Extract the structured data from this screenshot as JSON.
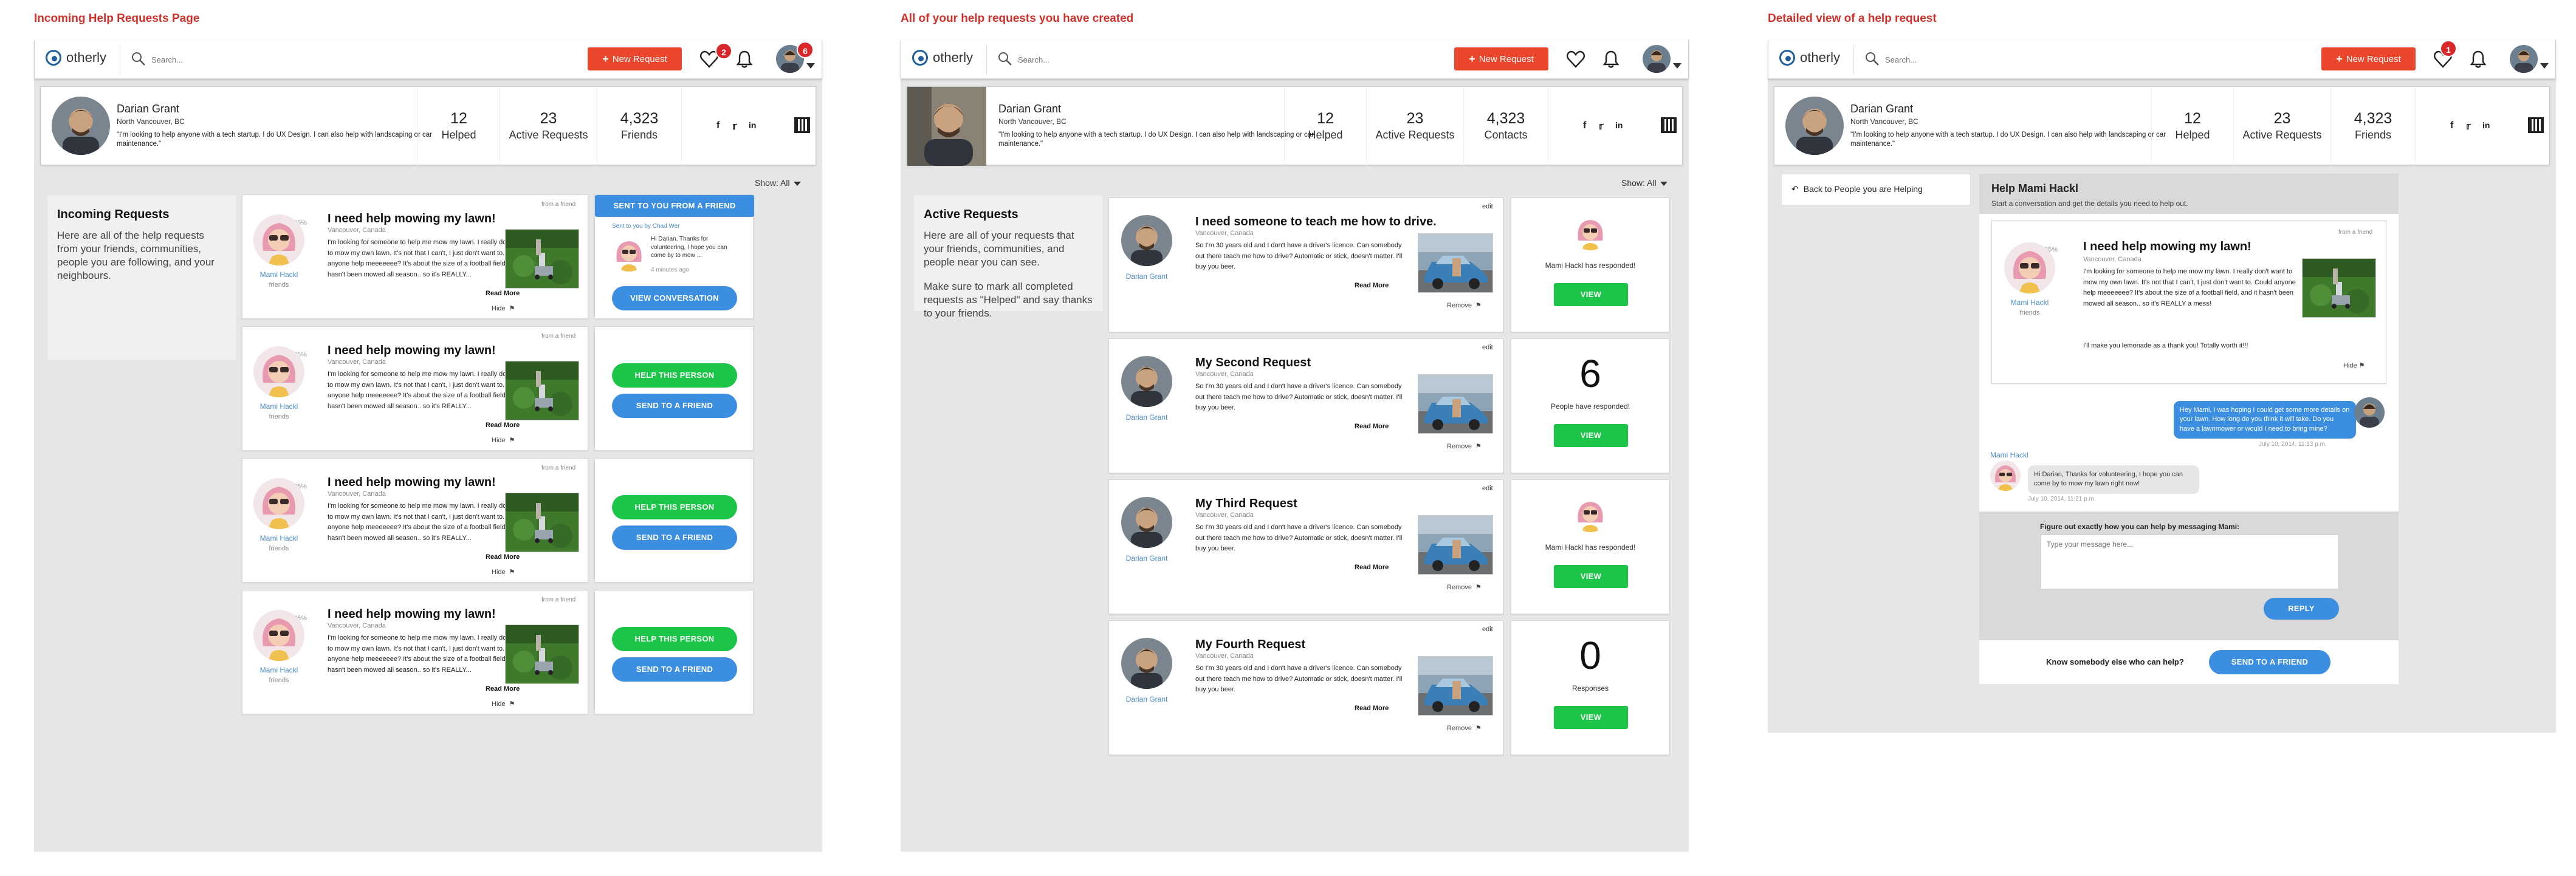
{
  "app": {
    "logo_text": "otherly",
    "search_placeholder": "Search...",
    "new_request_label": "New Request"
  },
  "colors": {
    "accent_red": "#e9462b",
    "green": "#1bc548",
    "blue": "#3b8ee0",
    "link_blue": "#4a8cc9",
    "title_red": "#d0302a"
  },
  "panels": [
    {
      "title": "Incoming Help Requests Page",
      "heart_badge": "2",
      "avatar_badge": "6",
      "profile": {
        "name": "Darian Grant",
        "location": "North Vancouver, BC",
        "bio": "\"I'm looking to help anyone with a tech startup. I do UX Design. I can also help with landscaping or car maintenance.\"",
        "stats": [
          {
            "value": "12",
            "label": "Helped"
          },
          {
            "value": "23",
            "label": "Active Requests"
          },
          {
            "value": "4,323",
            "label": "Friends"
          }
        ]
      },
      "show_filter": {
        "label": "Show:",
        "value": "All"
      },
      "sidebar": {
        "heading": "Incoming Requests",
        "paragraphs": [
          "Here are all of the help requests from your friends, communities, people you are following, and your neighbours."
        ]
      },
      "requests": [
        {
          "from": "from a friend",
          "pct": "85%",
          "name": "Mami Hackl",
          "relation": "friends",
          "title": "I need help mowing my lawn!",
          "location": "Vancouver, Canada",
          "body": "I'm looking for someone to help me mow my lawn. I really don't want to mow my own lawn. It's not that I can't, I just don't want to. Could anyone help meeeeeee? It's about the size of a football field, and it hasn't been mowed all season.. so it's REALLY...",
          "read_more": "Read More",
          "hide": "Hide"
        },
        {
          "from": "from a friend",
          "pct": "85%",
          "name": "Mami Hackl",
          "relation": "friends",
          "title": "I need help mowing my lawn!",
          "location": "Vancouver, Canada",
          "body": "I'm looking for someone to help me mow my lawn. I really don't want to mow my own lawn. It's not that I can't, I just don't want to. Could anyone help meeeeeee? It's about the size of a football field, and it hasn't been mowed all season.. so it's REALLY...",
          "read_more": "Read More",
          "hide": "Hide"
        },
        {
          "from": "from a friend",
          "pct": "85%",
          "name": "Mami Hackl",
          "relation": "friends",
          "title": "I need help mowing my lawn!",
          "location": "Vancouver, Canada",
          "body": "I'm looking for someone to help me mow my lawn. I really don't want to mow my own lawn. It's not that I can't, I just don't want to. Could anyone help meeeeeee? It's about the size of a football field, and it hasn't been mowed all season.. so it's REALLY...",
          "read_more": "Read More",
          "hide": "Hide"
        },
        {
          "from": "from a friend",
          "pct": "85%",
          "name": "Mami Hackl",
          "relation": "friends",
          "title": "I need help mowing my lawn!",
          "location": "Vancouver, Canada",
          "body": "I'm looking for someone to help me mow my lawn. I really don't want to mow my own lawn. It's not that I can't, I just don't want to. Could anyone help meeeeeee? It's about the size of a football field, and it hasn't been mowed all season.. so it's REALLY...",
          "read_more": "Read More",
          "hide": "Hide"
        }
      ],
      "actions": {
        "friend_header": "SENT TO YOU FROM A FRIEND",
        "sent_by": "Sent to you by Chad Wer",
        "message": "Hi Darian, Thanks for volunteering, I hope you can come by to mow ...",
        "time": "4 minutes ago",
        "view_conversation": "VIEW CONVERSATION",
        "help": "HELP THIS PERSON",
        "send": "SEND TO A FRIEND"
      }
    },
    {
      "title": "All of your help requests you have created",
      "profile": {
        "name": "Darian Grant",
        "location": "North Vancouver, BC",
        "bio": "\"I'm looking to help anyone with a tech startup. I do UX Design. I can also help with landscaping or car maintenance.\"",
        "stats": [
          {
            "value": "12",
            "label": "Helped"
          },
          {
            "value": "23",
            "label": "Active Requests"
          },
          {
            "value": "4,323",
            "label": "Contacts"
          }
        ]
      },
      "show_filter": {
        "label": "Show:",
        "value": "All"
      },
      "sidebar": {
        "heading": "Active Requests",
        "paragraphs": [
          "Here are all of your requests that your friends, communities, and people near you can see.",
          "Make sure to mark all completed requests as \"Helped\" and say thanks to your friends."
        ]
      },
      "requests": [
        {
          "edit": "edit",
          "name": "Darian Grant",
          "title": "I need someone to teach me how to drive.",
          "location": "Vancouver, Canada",
          "body": "So I'm 30 years old and I don't have a driver's licence.  Can somebody out there teach me how to drive? Automatic or stick, doesn't matter.  I'll buy you beer.",
          "read_more": "Read More",
          "remove": "Remove",
          "status_type": "avatar",
          "status_label": "Mami Hackl has responded!",
          "view": "VIEW"
        },
        {
          "edit": "edit",
          "name": "Darian Grant",
          "title": "My Second Request",
          "location": "Vancouver, Canada",
          "body": "So I'm 30 years old and I don't have a driver's licence.  Can somebody out there teach me how to drive? Automatic or stick, doesn't matter.  I'll buy you beer.",
          "read_more": "Read More",
          "remove": "Remove",
          "status_type": "number",
          "status_value": "6",
          "status_label": "People have responded!",
          "view": "VIEW"
        },
        {
          "edit": "edit",
          "name": "Darian Grant",
          "title": "My Third Request",
          "location": "Vancouver, Canada",
          "body": "So I'm 30 years old and I don't have a driver's licence.  Can somebody out there teach me how to drive? Automatic or stick, doesn't matter.  I'll buy you beer.",
          "read_more": "Read More",
          "remove": "Remove",
          "status_type": "avatar",
          "status_label": "Mami Hackl has responded!",
          "view": "VIEW"
        },
        {
          "edit": "edit",
          "name": "Darian Grant",
          "title": "My Fourth Request",
          "location": "Vancouver, Canada",
          "body": "So I'm 30 years old and I don't have a driver's licence.  Can somebody out there teach me how to drive? Automatic or stick, doesn't matter.  I'll buy you beer.",
          "read_more": "Read More",
          "remove": "Remove",
          "status_type": "number",
          "status_value": "0",
          "status_label": "Responses",
          "view": "VIEW"
        }
      ]
    },
    {
      "title": "Detailed view of a help request",
      "heart_badge": "1",
      "profile": {
        "name": "Darian Grant",
        "location": "North Vancouver, BC",
        "bio": "\"I'm looking to help anyone with a tech startup. I do UX Design. I can also help with landscaping or car maintenance.\"",
        "stats": [
          {
            "value": "12",
            "label": "Helped"
          },
          {
            "value": "23",
            "label": "Active Requests"
          },
          {
            "value": "4,323",
            "label": "Friends"
          }
        ]
      },
      "back_label": "Back to People you are Helping",
      "detail": {
        "heading": "Help Mami Hackl",
        "subheading": "Start a conversation and get the details you need to help out.",
        "from": "from a friend",
        "pct": "85%",
        "name": "Mami Hackl",
        "relation": "friends",
        "title": "I need help mowing my lawn!",
        "location": "Vancouver, Canada",
        "body": "I'm looking for someone to help me mow my lawn. I really don't want to mow my own lawn. It's not that I can't, I just don't want to. Could anyone help meeeeeee? It's about the size of a football field, and it hasn't been mowed all season.. so it's REALLY a mess!",
        "extra": "I'll make you lemonade as a thank you! Totally worth it!!!",
        "hide": "Hide",
        "my_message": "Hey Mami, I was hoping I could get some more details on your lawn. How long do you think it will take. Do you have a lawnmower or would I need to bring mine?",
        "my_time": "July 10, 2014, 11:13 p.m.",
        "reply_name": "Mami Hackl",
        "reply_message": "Hi Darian, Thanks for volunteering, I hope you can come by to mow my lawn right now!",
        "reply_time": "July 10, 2014, 11:21 p.m.",
        "prompt": "Figure out exactly how you can help by messaging Mami:",
        "placeholder": "Type your message here...",
        "reply_button": "REPLY",
        "know_text": "Know somebody else who can help?",
        "send_button": "SEND TO A FRIEND"
      }
    }
  ]
}
